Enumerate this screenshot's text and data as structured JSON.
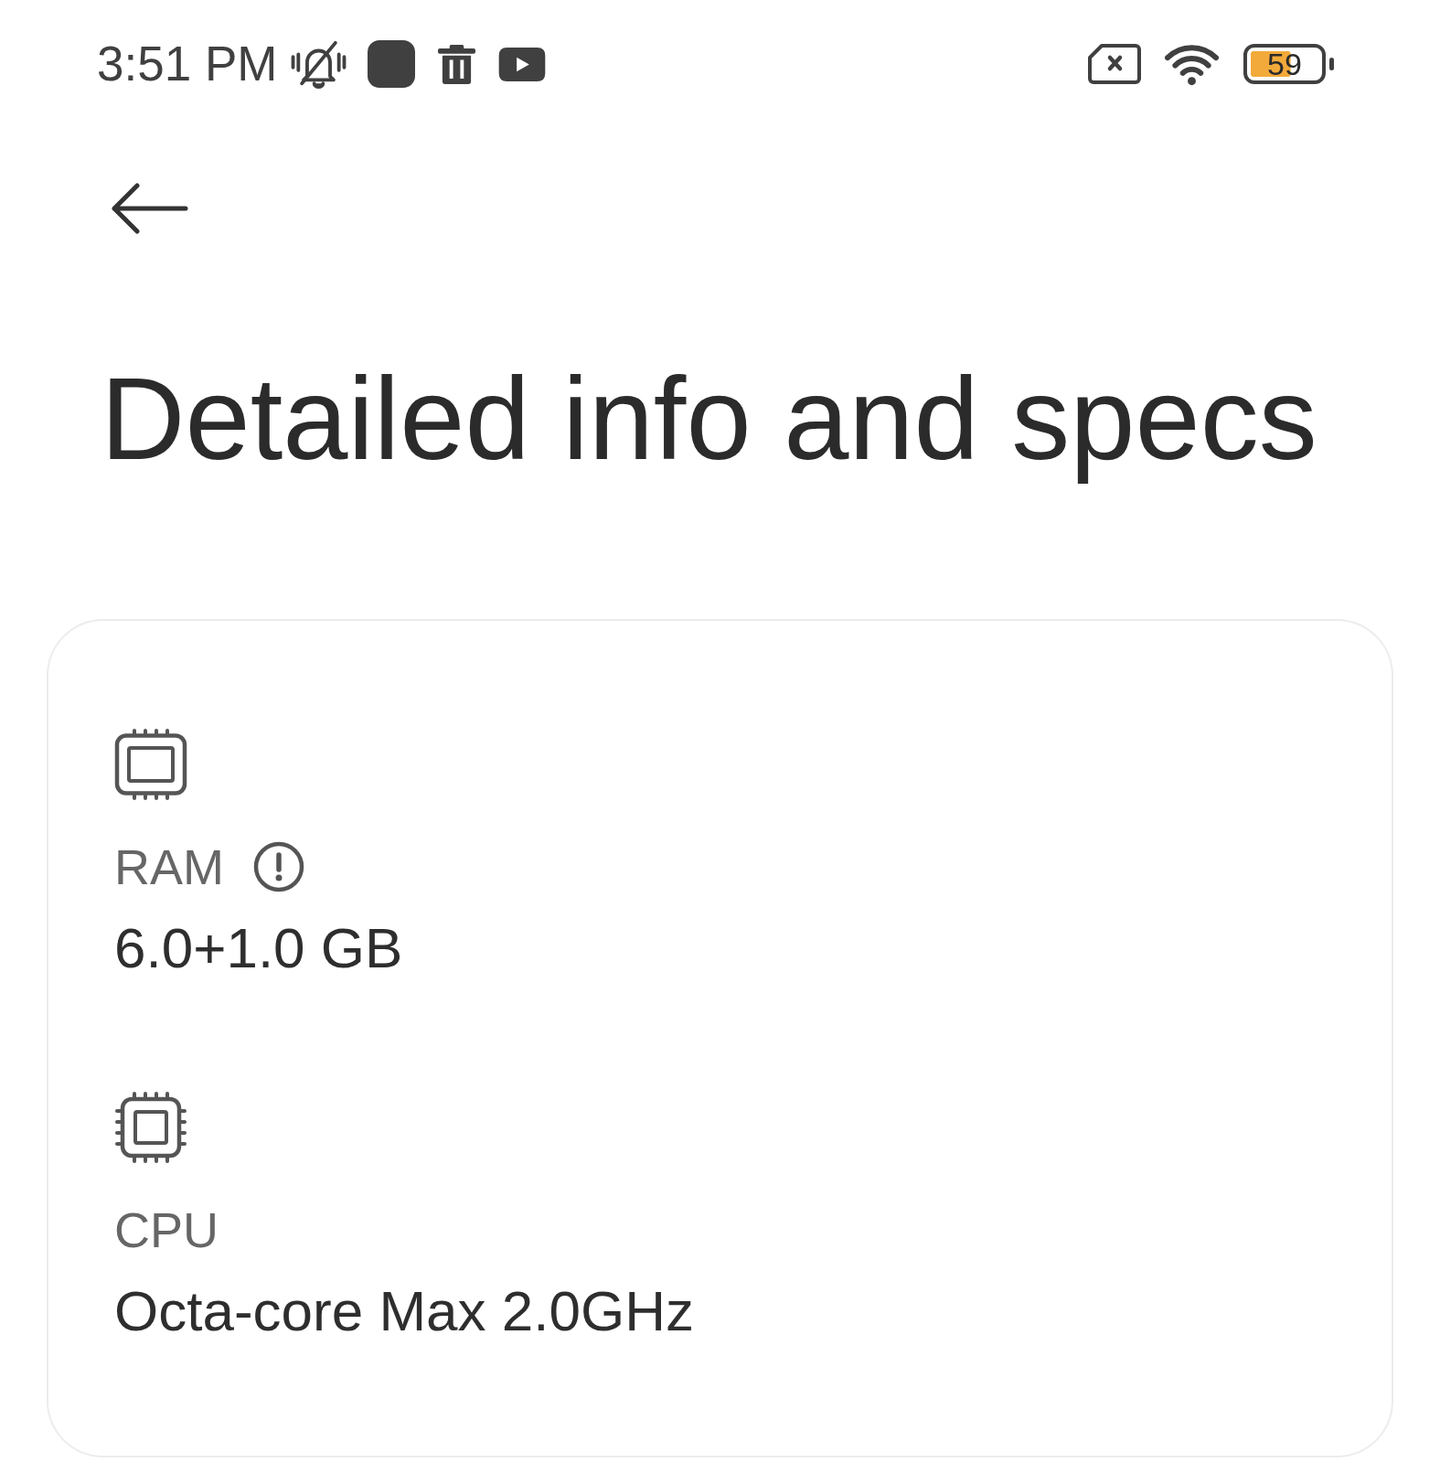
{
  "status_bar": {
    "time": "3:51 PM",
    "battery": "59"
  },
  "header": {
    "title": "Detailed info and specs"
  },
  "specs": [
    {
      "kind": "ram",
      "label": "RAM",
      "info": true,
      "value": "6.0+1.0 GB"
    },
    {
      "kind": "cpu",
      "label": "CPU",
      "info": false,
      "value": "Octa-core Max 2.0GHz"
    }
  ]
}
